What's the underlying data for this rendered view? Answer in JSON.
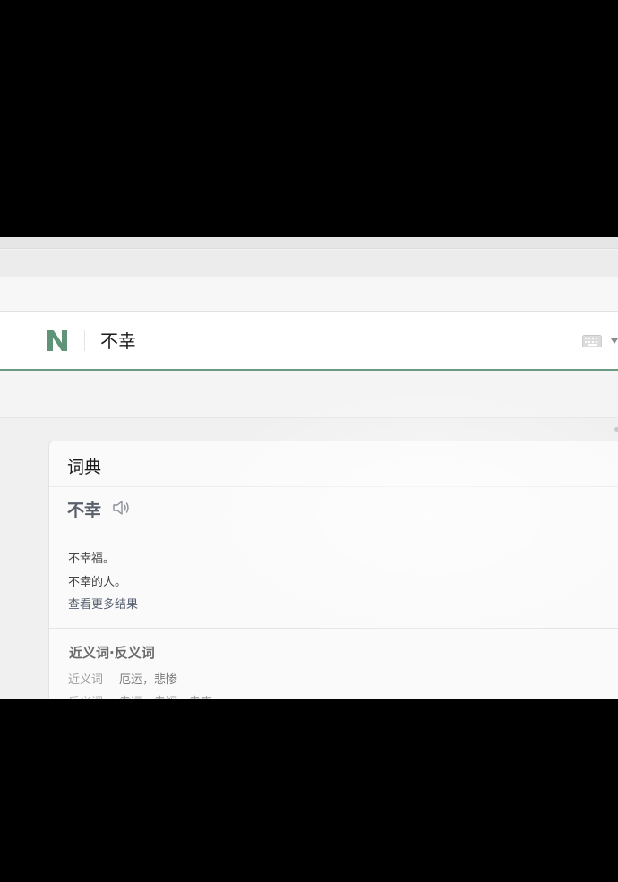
{
  "search": {
    "logo_letter": "N",
    "query": "不幸",
    "keyboard_icon": "keyboard-icon",
    "dropdown_icon": "chevron-down-icon"
  },
  "dictionary": {
    "title": "词典",
    "entry_word": "不幸",
    "speaker_icon": "speaker-icon",
    "examples": [
      "不幸福。",
      "不幸的人。"
    ],
    "more_link": "查看更多结果"
  },
  "synonyms": {
    "heading": "近义词·反义词",
    "synonym_label": "近义词",
    "synonym_value": "厄运，悲惨",
    "antonym_label": "反义词",
    "antonym_value": "幸运，幸福，幸事"
  },
  "colors": {
    "brand": "#5f9478",
    "accent_underline": "#6b9a83"
  }
}
